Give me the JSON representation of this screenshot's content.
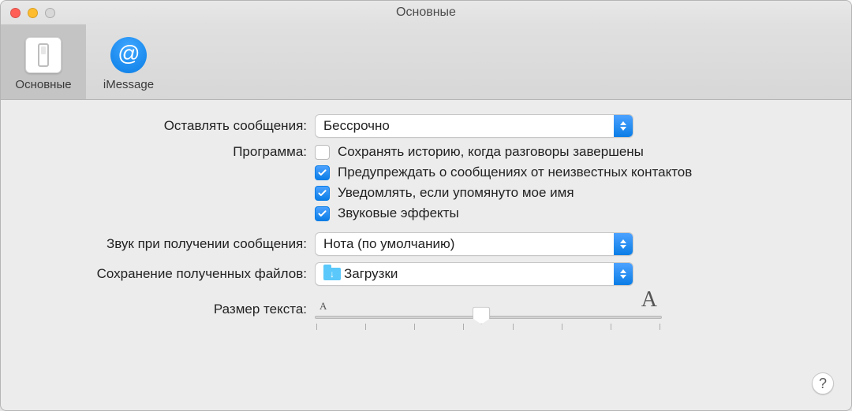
{
  "window": {
    "title": "Основные"
  },
  "tabs": {
    "general": "Основные",
    "imessage": "iMessage"
  },
  "form": {
    "keep_messages_label": "Оставлять сообщения:",
    "keep_messages_value": "Бессрочно",
    "application_label": "Программа:",
    "checkboxes": {
      "save_history": {
        "label": "Сохранять историю, когда разговоры завершены",
        "checked": false
      },
      "warn_unknown": {
        "label": "Предупреждать о сообщениях от неизвестных контактов",
        "checked": true
      },
      "notify_mention": {
        "label": "Уведомлять, если упомянуто мое имя",
        "checked": true
      },
      "sound_effects": {
        "label": "Звуковые эффекты",
        "checked": true
      }
    },
    "sound_label": "Звук при получении сообщения:",
    "sound_value": "Нота (по умолчанию)",
    "save_files_label": "Сохранение полученных файлов:",
    "save_files_value": "Загрузки",
    "text_size_label": "Размер текста:",
    "small_a": "A",
    "big_a": "A"
  },
  "help_label": "?"
}
